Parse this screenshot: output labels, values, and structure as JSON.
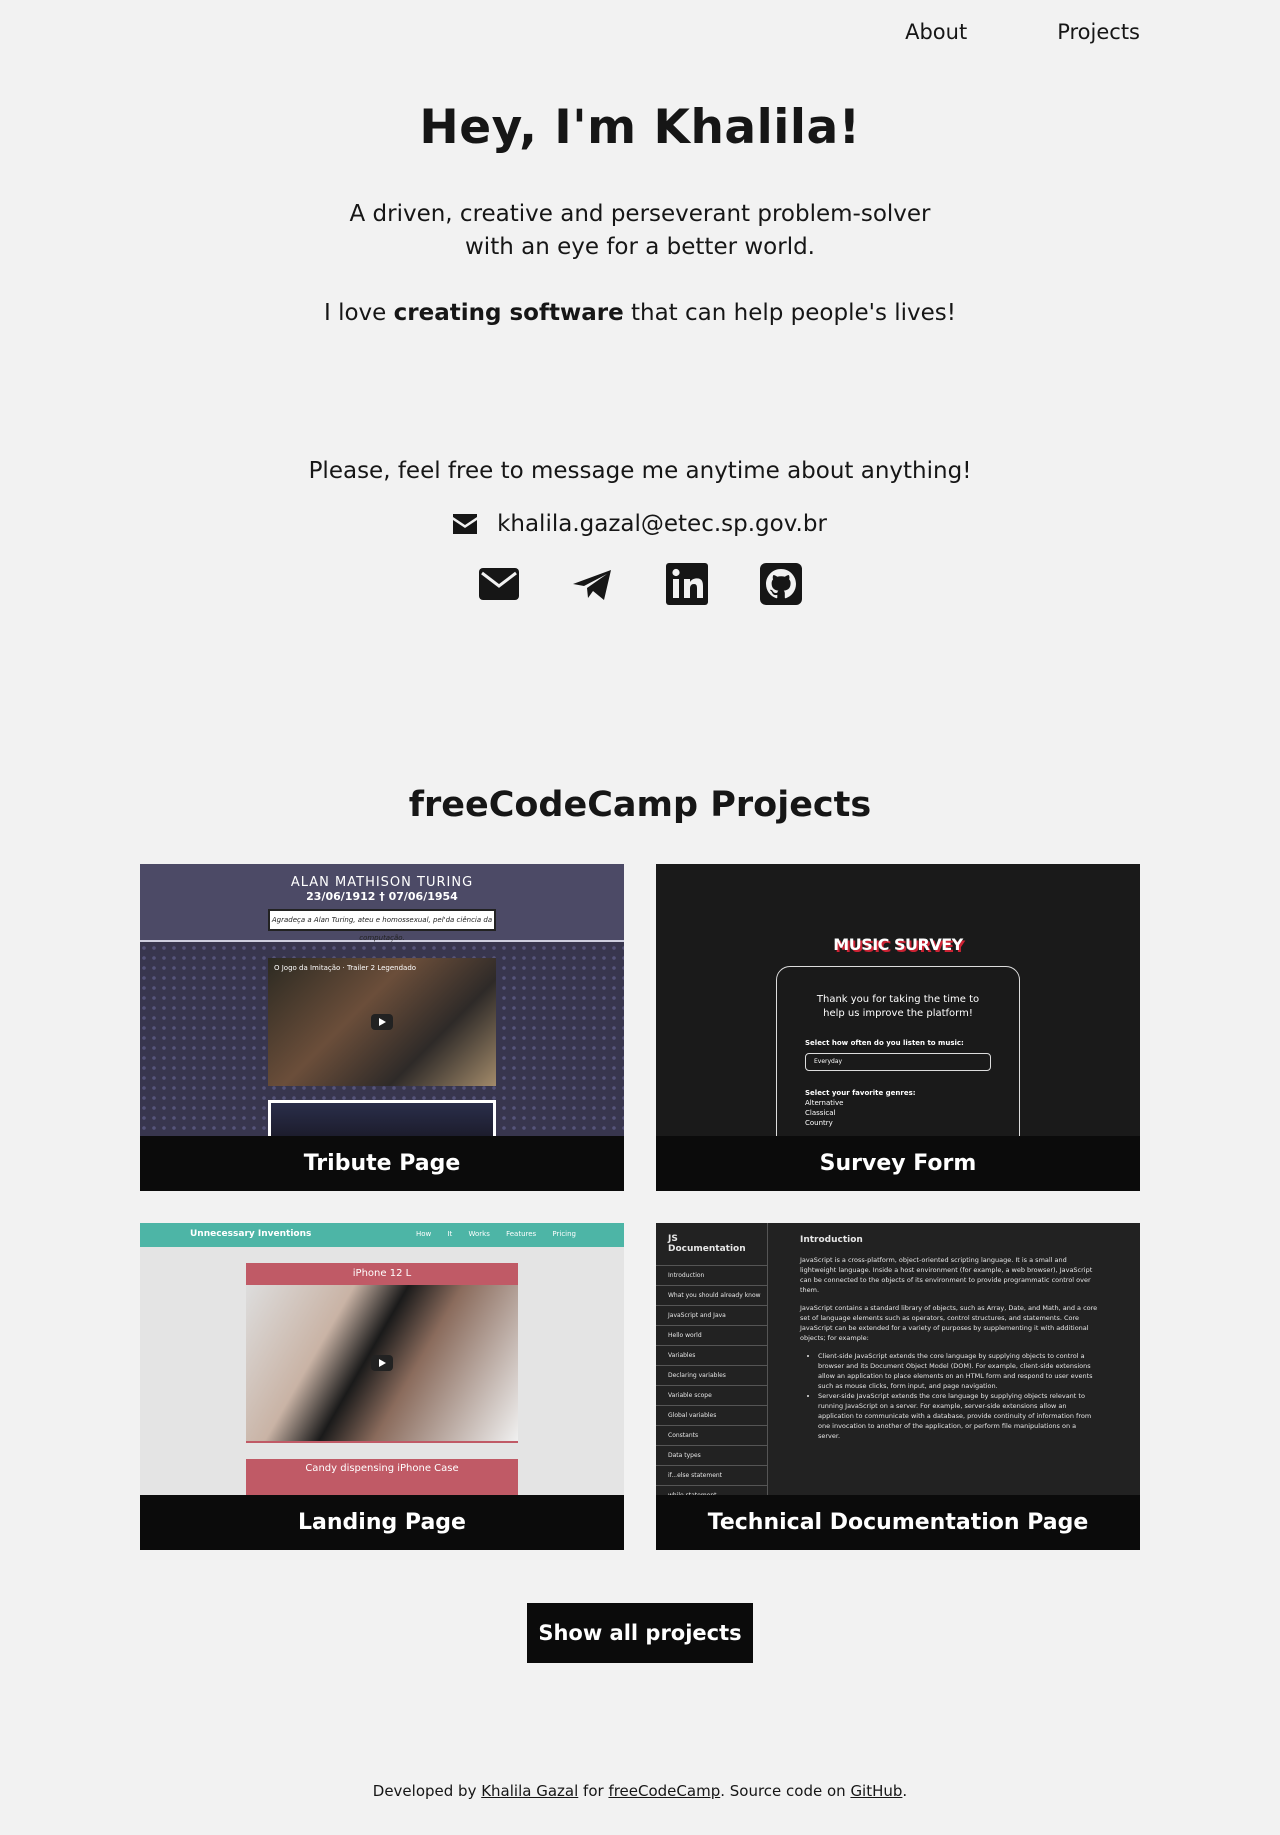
{
  "nav": {
    "about": "About",
    "projects": "Projects"
  },
  "hero": {
    "title": "Hey, I'm Khalila!",
    "tagline_line1": "A driven, creative and perseverant problem-solver",
    "tagline_line2": "with an eye for a better world.",
    "love_prefix": "I love ",
    "love_bold": "creating software",
    "love_suffix": " that can help people's lives!"
  },
  "contact": {
    "invite": "Please, feel free to message me anytime about anything!",
    "email": "khalila.gazal@etec.sp.gov.br",
    "socials": [
      "envelope-icon",
      "telegram-icon",
      "linkedin-icon",
      "github-icon"
    ]
  },
  "projects": {
    "title": "freeCodeCamp Projects",
    "cards": [
      {
        "caption": "Tribute Page"
      },
      {
        "caption": "Survey Form"
      },
      {
        "caption": "Landing Page"
      },
      {
        "caption": "Technical Documentation Page"
      }
    ],
    "show_all": "Show all projects"
  },
  "thumbs": {
    "tribute": {
      "name": "ALAN MATHISON TURING",
      "dates": "23/06/1912 † 07/06/1954",
      "quote": "Agradeça a Alan Turing, ateu e homossexual, pel'da ciência da computação.",
      "video": "O Jogo da Imitação · Trailer 2 Legendado"
    },
    "survey": {
      "title": "MUSIC SURVEY",
      "thanks": "Thank you for taking the time to help us improve the platform!",
      "q1": "Select how often do you listen to music:",
      "q1_value": "Everyday",
      "q2": "Select your favorite genres:",
      "genres": [
        "Alternative",
        "Classical",
        "Country"
      ]
    },
    "landing": {
      "brand": "Unnecessary Inventions",
      "links": "How It Works Features Pricing",
      "box1": "iPhone 12 L",
      "box2": "Candy dispensing iPhone Case"
    },
    "doc": {
      "side_title": "JS Documentation",
      "side_items": [
        "Introduction",
        "What you should already know",
        "JavaScript and Java",
        "Hello world",
        "Variables",
        "Declaring variables",
        "Variable scope",
        "Global variables",
        "Constants",
        "Data types",
        "if...else statement",
        "while statement"
      ],
      "main_title": "Introduction",
      "p1": "JavaScript is a cross-platform, object-oriented scripting language. It is a small and lightweight language. Inside a host environment (for example, a web browser), JavaScript can be connected to the objects of its environment to provide programmatic control over them.",
      "p2": "JavaScript contains a standard library of objects, such as Array, Date, and Math, and a core set of language elements such as operators, control structures, and statements. Core JavaScript can be extended for a variety of purposes by supplementing it with additional objects; for example:",
      "li1": "Client-side JavaScript extends the core language by supplying objects to control a browser and its Document Object Model (DOM). For example, client-side extensions allow an application to place elements on an HTML form and respond to user events such as mouse clicks, form input, and page navigation.",
      "li2": "Server-side JavaScript extends the core language by supplying objects relevant to running JavaScript on a server. For example, server-side extensions allow an application to communicate with a database, provide continuity of information from one invocation to another of the application, or perform file manipulations on a server."
    }
  },
  "footer": {
    "developed_by": "Developed by ",
    "author": "Khalila Gazal",
    "for": " for ",
    "fcc": "freeCodeCamp",
    "source": ". Source code on ",
    "github": "GitHub",
    "end": "."
  }
}
